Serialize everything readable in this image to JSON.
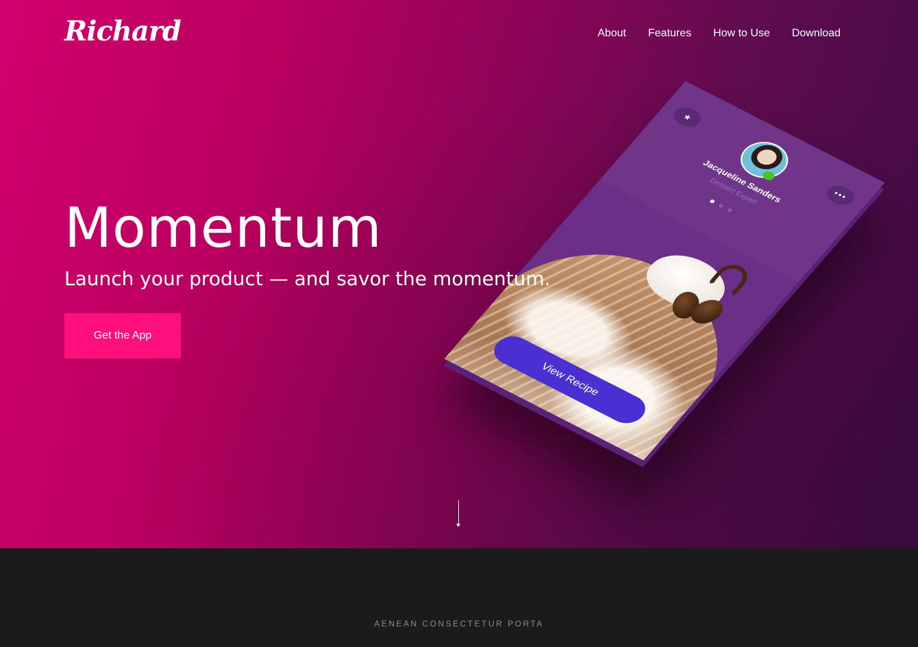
{
  "brand": {
    "logo_text": "Richard"
  },
  "nav": {
    "items": [
      "About",
      "Features",
      "How to Use",
      "Download"
    ]
  },
  "hero": {
    "headline": "Momentum",
    "tagline": "Launch your product — and savor the momentum.",
    "cta_label": "Get the App"
  },
  "phone": {
    "star_icon_glyph": "★",
    "more_icon_glyph": "•••",
    "profile_name": "Jacqueline Sanders",
    "profile_role": "Dessert Expert",
    "carousel": {
      "count": 3,
      "active": 0
    },
    "button_label": "View Recipe"
  },
  "section": {
    "eyebrow": "AENEAN CONSECTETUR PORTA"
  },
  "colors": {
    "gradient_start": "#d2006d",
    "gradient_end": "#3f0b44",
    "cta_bg": "#ff0f7b",
    "phone_bg": "#6a2f86",
    "phone_button_bg": "#4a2fd1",
    "dark_section_bg": "#1b1b1b"
  },
  "icons": {
    "scroll": "arrow-down-icon",
    "star": "star-icon",
    "more": "more-icon"
  }
}
